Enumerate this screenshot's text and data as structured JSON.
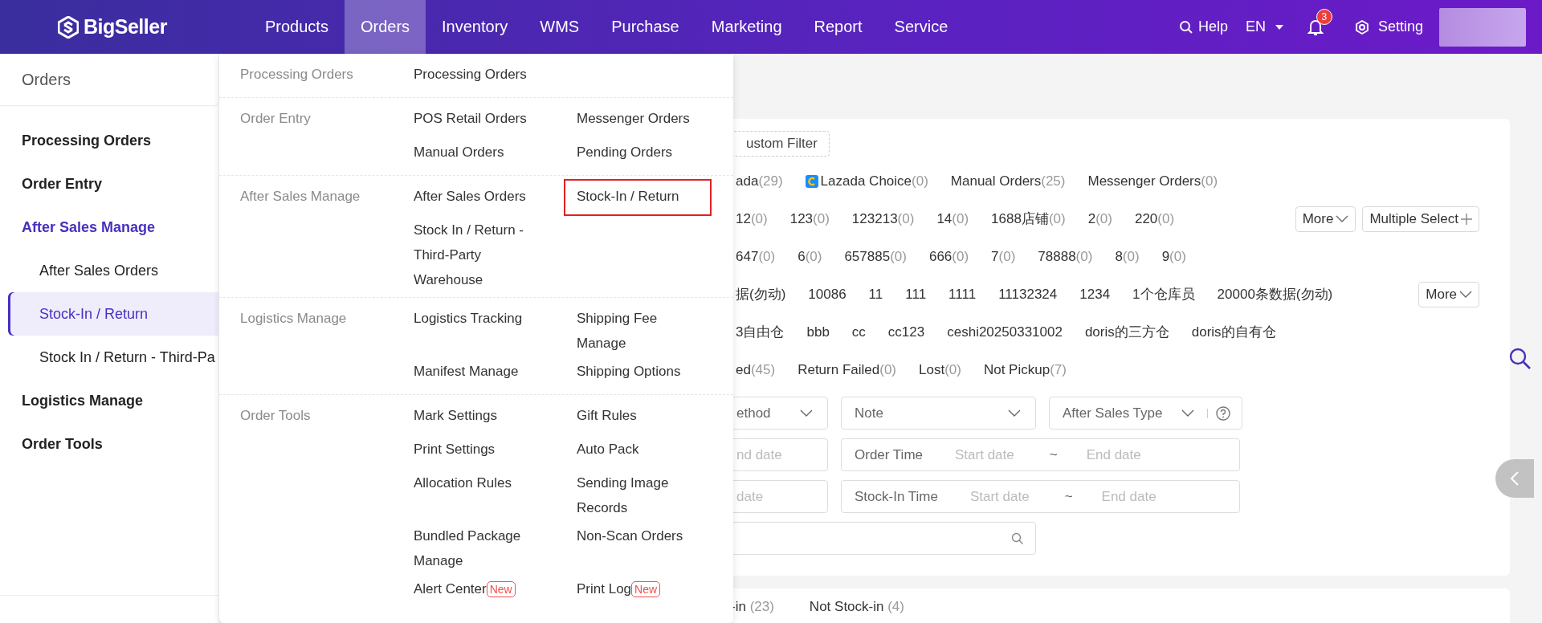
{
  "topbar": {
    "logo": "BigSeller",
    "nav": [
      {
        "label": "Products",
        "selected": false
      },
      {
        "label": "Orders",
        "selected": true
      },
      {
        "label": "Inventory",
        "selected": false
      },
      {
        "label": "WMS",
        "selected": false
      },
      {
        "label": "Purchase",
        "selected": false
      },
      {
        "label": "Marketing",
        "selected": false
      },
      {
        "label": "Report",
        "selected": false
      },
      {
        "label": "Service",
        "selected": false
      }
    ],
    "help": "Help",
    "language": "EN",
    "notifications": "3",
    "setting": "Setting"
  },
  "sidebar": {
    "title": "Orders",
    "items": [
      {
        "label": "Processing Orders",
        "active": false
      },
      {
        "label": "Order Entry",
        "active": false
      },
      {
        "label": "After Sales Manage",
        "active": true,
        "children": [
          {
            "label": "After Sales Orders",
            "selected": false
          },
          {
            "label": "Stock-In / Return",
            "selected": true
          },
          {
            "label": "Stock In / Return - Third-Pa",
            "selected": false
          }
        ]
      },
      {
        "label": "Logistics Manage",
        "active": false
      },
      {
        "label": "Order Tools",
        "active": false
      }
    ]
  },
  "dropdown": {
    "groups": [
      {
        "label": "Processing Orders",
        "items": [
          {
            "label": "Processing Orders",
            "highlighted": false
          }
        ]
      },
      {
        "label": "Order Entry",
        "items": [
          {
            "label": "POS Retail Orders",
            "highlighted": false
          },
          {
            "label": "Messenger Orders",
            "highlighted": false
          },
          {
            "label": "Manual Orders",
            "highlighted": false
          },
          {
            "label": "Pending Orders",
            "highlighted": false
          }
        ]
      },
      {
        "label": "After Sales Manage",
        "items": [
          {
            "label": "After Sales Orders",
            "highlighted": false
          },
          {
            "label": "Stock-In / Return",
            "highlighted": true
          },
          {
            "label": "Stock In / Return - Third-Party Warehouse",
            "highlighted": false
          }
        ]
      },
      {
        "label": "Logistics Manage",
        "items": [
          {
            "label": "Logistics Tracking",
            "highlighted": false
          },
          {
            "label": "Shipping Fee Manage",
            "highlighted": false
          },
          {
            "label": "Manifest Manage",
            "highlighted": false
          },
          {
            "label": "Shipping Options",
            "highlighted": false
          }
        ]
      },
      {
        "label": "Order Tools",
        "items": [
          {
            "label": "Mark Settings",
            "highlighted": false
          },
          {
            "label": "Gift Rules",
            "highlighted": false
          },
          {
            "label": "Print Settings",
            "highlighted": false
          },
          {
            "label": "Auto Pack",
            "highlighted": false
          },
          {
            "label": "Allocation Rules",
            "highlighted": false
          },
          {
            "label": "Sending Image Records",
            "highlighted": false
          },
          {
            "label": "Bundled Package Manage",
            "highlighted": false
          },
          {
            "label": "Non-Scan Orders",
            "highlighted": false
          },
          {
            "label": "Alert Center",
            "badge": "New",
            "highlighted": false
          },
          {
            "label": "Print Log",
            "badge": "New",
            "highlighted": false
          }
        ]
      }
    ]
  },
  "filters": {
    "custom_filter": "ustom Filter",
    "rows": [
      {
        "items": [
          {
            "label": "ada",
            "count": "(29)"
          },
          {
            "label": "Lazada Choice",
            "count": "(0)",
            "logo": true
          },
          {
            "label": "Manual Orders",
            "count": "(25)"
          },
          {
            "label": "Messenger Orders",
            "count": "(0)"
          }
        ]
      },
      {
        "items": [
          {
            "label": "12",
            "count": "(0)"
          },
          {
            "label": "123",
            "count": "(0)"
          },
          {
            "label": "123213",
            "count": "(0)"
          },
          {
            "label": "14",
            "count": "(0)"
          },
          {
            "label": "1688店铺",
            "count": "(0)"
          },
          {
            "label": "2",
            "count": "(0)"
          },
          {
            "label": "220",
            "count": "(0)"
          }
        ],
        "buttons": [
          {
            "label": "More",
            "kind": "dropdown"
          },
          {
            "label": "Multiple Select",
            "kind": "add"
          }
        ]
      },
      {
        "items": [
          {
            "label": "647",
            "count": "(0)"
          },
          {
            "label": "6",
            "count": "(0)"
          },
          {
            "label": "657885",
            "count": "(0)"
          },
          {
            "label": "666",
            "count": "(0)"
          },
          {
            "label": "7",
            "count": "(0)"
          },
          {
            "label": "78888",
            "count": "(0)"
          },
          {
            "label": "8",
            "count": "(0)"
          },
          {
            "label": "9",
            "count": "(0)"
          }
        ]
      },
      {
        "items": [
          {
            "label": "据(勿动)"
          },
          {
            "label": "10086"
          },
          {
            "label": "11"
          },
          {
            "label": "111"
          },
          {
            "label": "1111"
          },
          {
            "label": "11132324"
          },
          {
            "label": "1234"
          },
          {
            "label": "1个仓库员"
          },
          {
            "label": "20000条数据(勿动)"
          }
        ],
        "buttons": [
          {
            "label": "More",
            "kind": "dropdown"
          }
        ]
      },
      {
        "items": [
          {
            "label": "3自由仓"
          },
          {
            "label": "bbb"
          },
          {
            "label": "cc"
          },
          {
            "label": "cc123"
          },
          {
            "label": "ceshi20250331002"
          },
          {
            "label": "doris的三方仓"
          },
          {
            "label": "doris的自有仓"
          }
        ]
      },
      {
        "items": [
          {
            "label": "ed",
            "count": "(45)"
          },
          {
            "label": "Return Failed",
            "count": "(0)"
          },
          {
            "label": "Lost",
            "count": "(0)"
          },
          {
            "label": "Not Pickup",
            "count": "(7)"
          }
        ]
      }
    ],
    "selects": [
      {
        "label": "ethod",
        "kind": "select"
      },
      {
        "label": "Note",
        "kind": "select"
      },
      {
        "label": "After Sales Type",
        "kind": "select-help"
      }
    ],
    "date_rows": [
      {
        "partial": "nd date",
        "label": "Order Time",
        "start": "Start date",
        "separator": "~",
        "end": "End date"
      },
      {
        "partial": "date",
        "label": "Stock-In Time",
        "start": "Start date",
        "separator": "~",
        "end": "End date"
      }
    ]
  },
  "tabs": [
    {
      "label": "-in",
      "count": "(23)"
    },
    {
      "label": "Not Stock-in",
      "count": "(4)"
    }
  ]
}
